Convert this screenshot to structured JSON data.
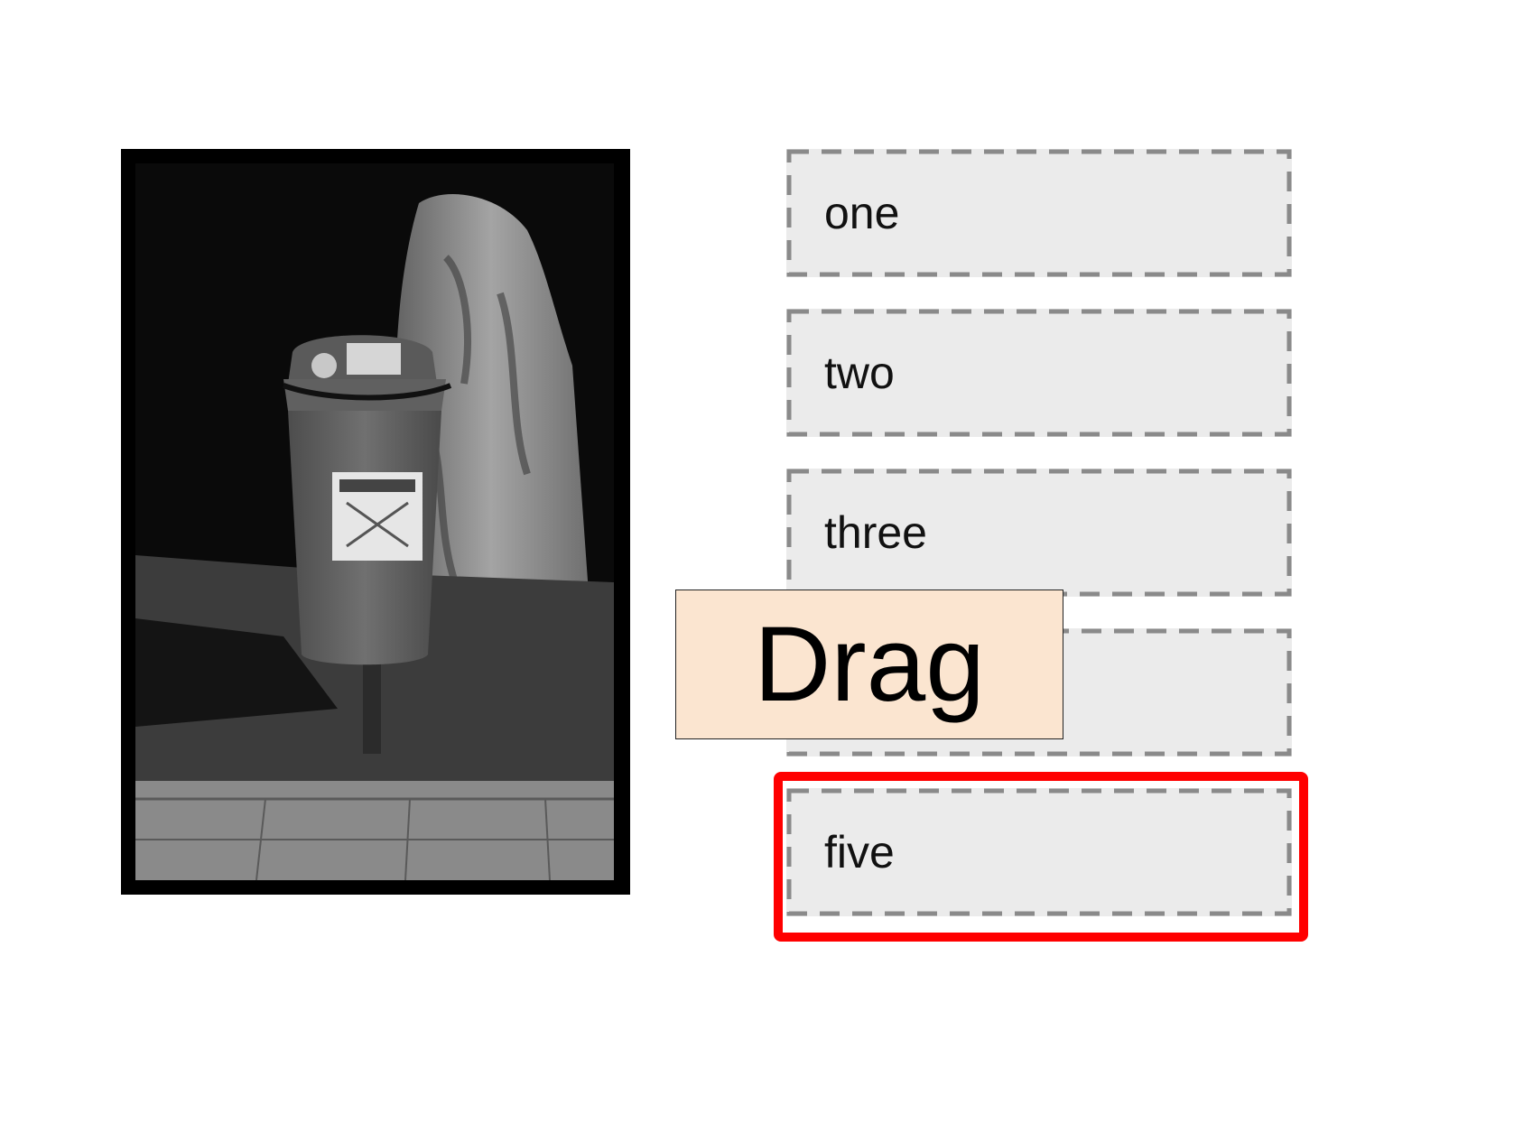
{
  "photo": {
    "alt": "street litter bin photo"
  },
  "dropzones": [
    {
      "label": "one"
    },
    {
      "label": "two"
    },
    {
      "label": "three"
    },
    {
      "label": ""
    },
    {
      "label": "five"
    }
  ],
  "drag_item": {
    "label": "Drag"
  },
  "colors": {
    "zone_bg": "#ebebeb",
    "zone_dash": "#8a8a8a",
    "highlight": "#ff0000",
    "drag_bg": "#fbe5d0"
  }
}
